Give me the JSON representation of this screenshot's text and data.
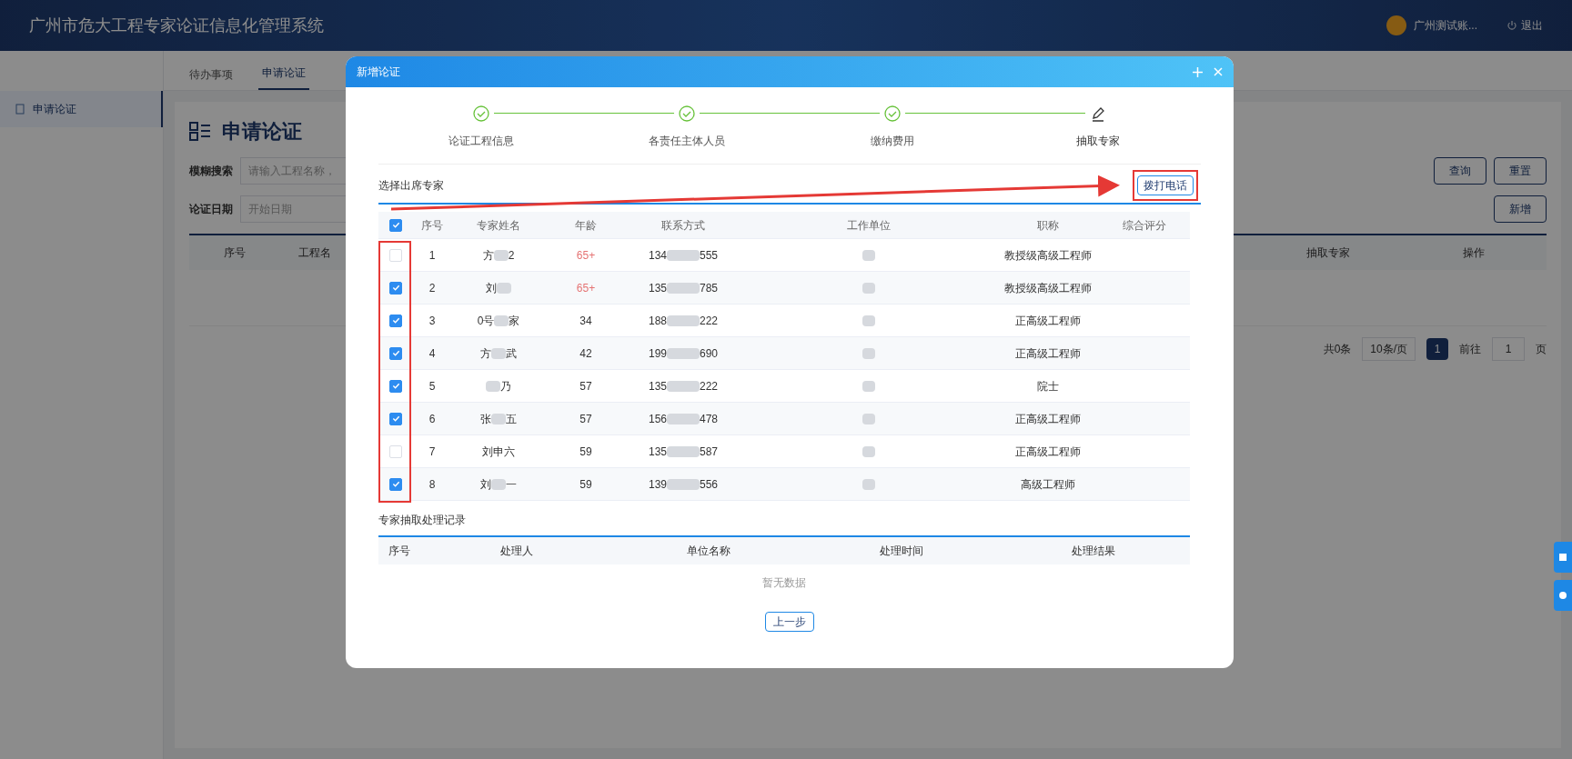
{
  "header": {
    "title": "广州市危大工程专家论证信息化管理系统",
    "user": "广州测试账...",
    "logout": "退出"
  },
  "tabs": [
    {
      "label": "待办事项",
      "selected": false
    },
    {
      "label": "申请论证",
      "selected": true
    }
  ],
  "sidebar": {
    "items": [
      {
        "label": "申请论证",
        "selected": true
      }
    ]
  },
  "page": {
    "title": "申请论证",
    "filters": [
      {
        "label": "模糊搜索",
        "placeholder": "请输入工程名称，"
      },
      {
        "label": "论证日期",
        "placeholder": "开始日期"
      }
    ],
    "buttons": [
      "查询",
      "重置"
    ],
    "add_button": "新增",
    "table": {
      "columns": [
        "序号",
        "工程名",
        "抽取专家",
        "操作"
      ]
    },
    "pagination": {
      "total": "共0条",
      "page_size": "10条/页",
      "pages": [
        {
          "label": "1",
          "selected": true
        }
      ],
      "goto": "前往",
      "goto_value": "1",
      "goto_unit": "页"
    }
  },
  "dialog": {
    "title": "新增论证",
    "steps": [
      {
        "label": "论证工程信息",
        "kind": "done"
      },
      {
        "label": "各责任主体人员",
        "kind": "done"
      },
      {
        "label": "缴纳费用",
        "kind": "done"
      },
      {
        "label": "抽取专家",
        "kind": "current"
      }
    ],
    "section_title": "选择出席专家",
    "call_button": "拨打电话",
    "experts": {
      "all_checked": true,
      "columns": [
        "序号",
        "专家姓名",
        "年龄",
        "联系方式",
        "工作单位",
        "职称",
        "综合评分"
      ],
      "rows": [
        {
          "checked": false,
          "index": "1",
          "name_before": "方",
          "name_masked": true,
          "name_after": "2",
          "age": "65+",
          "age_alert": true,
          "phone_before": "134",
          "phone_after": "555",
          "title": "教授级高级工程师"
        },
        {
          "checked": true,
          "index": "2",
          "name_before": "刘",
          "name_masked": true,
          "age": "65+",
          "age_alert": true,
          "phone_before": "135",
          "phone_after": "785",
          "title": "教授级高级工程师"
        },
        {
          "checked": true,
          "index": "3",
          "name_before": "0号",
          "name_masked": true,
          "name_after": "家",
          "age": "34",
          "age_alert": false,
          "phone_before": "188",
          "phone_after": "222",
          "title": "正高级工程师"
        },
        {
          "checked": true,
          "index": "4",
          "name_before": "方",
          "name_masked": true,
          "name_after": "武",
          "age": "42",
          "age_alert": false,
          "phone_before": "199",
          "phone_after": "690",
          "title": "正高级工程师"
        },
        {
          "checked": true,
          "index": "5",
          "name_masked": true,
          "name_after": "乃",
          "age": "57",
          "age_alert": false,
          "phone_before": "135",
          "phone_after": "222",
          "title": "院士"
        },
        {
          "checked": true,
          "index": "6",
          "name_before": "张",
          "name_masked": true,
          "name_after": "五",
          "age": "57",
          "age_alert": false,
          "phone_before": "156",
          "phone_after": "478",
          "title": "正高级工程师"
        },
        {
          "checked": false,
          "index": "7",
          "name_before": "刘申六",
          "name_masked": false,
          "age": "59",
          "age_alert": false,
          "phone_before": "135",
          "phone_after": "587",
          "title": "正高级工程师"
        },
        {
          "checked": true,
          "index": "8",
          "name_before": "刘",
          "name_masked": true,
          "name_after": "一",
          "age": "59",
          "age_alert": false,
          "phone_before": "139",
          "phone_after": "556",
          "title": "高级工程师"
        }
      ]
    },
    "records_title": "专家抽取处理记录",
    "records": {
      "columns": [
        "序号",
        "处理人",
        "单位名称",
        "处理时间",
        "处理结果"
      ],
      "empty": "暂无数据"
    },
    "prev_button": "上一步"
  }
}
